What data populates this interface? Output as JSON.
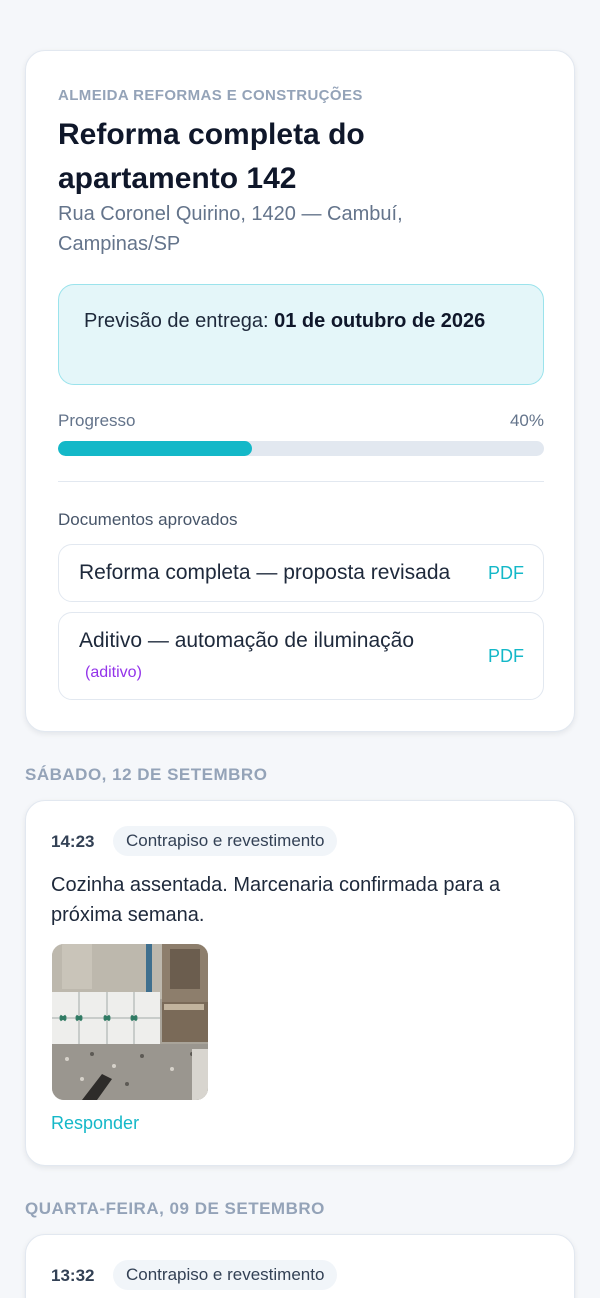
{
  "project": {
    "company": "ALMEIDA REFORMAS E CONSTRUÇÕES",
    "title": "Reforma completa do apartamento 142",
    "address": "Rua Coronel Quirino, 1420 — Cambuí, Campinas/SP",
    "delivery_label": "Previsão de entrega:",
    "delivery_date": "01 de outubro de 2026",
    "progress_label": "Progresso",
    "progress_text": "40%",
    "progress_value": 0.4,
    "accent_color": "#14b8c8"
  },
  "documents": {
    "label": "Documentos aprovados",
    "items": [
      {
        "name": "Reforma completa — proposta revisada",
        "tag": "",
        "action": "PDF"
      },
      {
        "name": "Aditivo — automação de iluminação",
        "tag": "(aditivo)",
        "action": "PDF"
      }
    ]
  },
  "timeline": [
    {
      "date": "SÁBADO, 12 DE SETEMBRO",
      "time": "14:23",
      "category": "Contrapiso e revestimento",
      "message": "Cozinha assentada. Marcenaria confirmada para a próxima semana.",
      "reply": "Responder"
    },
    {
      "date": "QUARTA-FEIRA, 09 DE SETEMBRO",
      "time": "13:32",
      "category": "Contrapiso e revestimento"
    }
  ]
}
